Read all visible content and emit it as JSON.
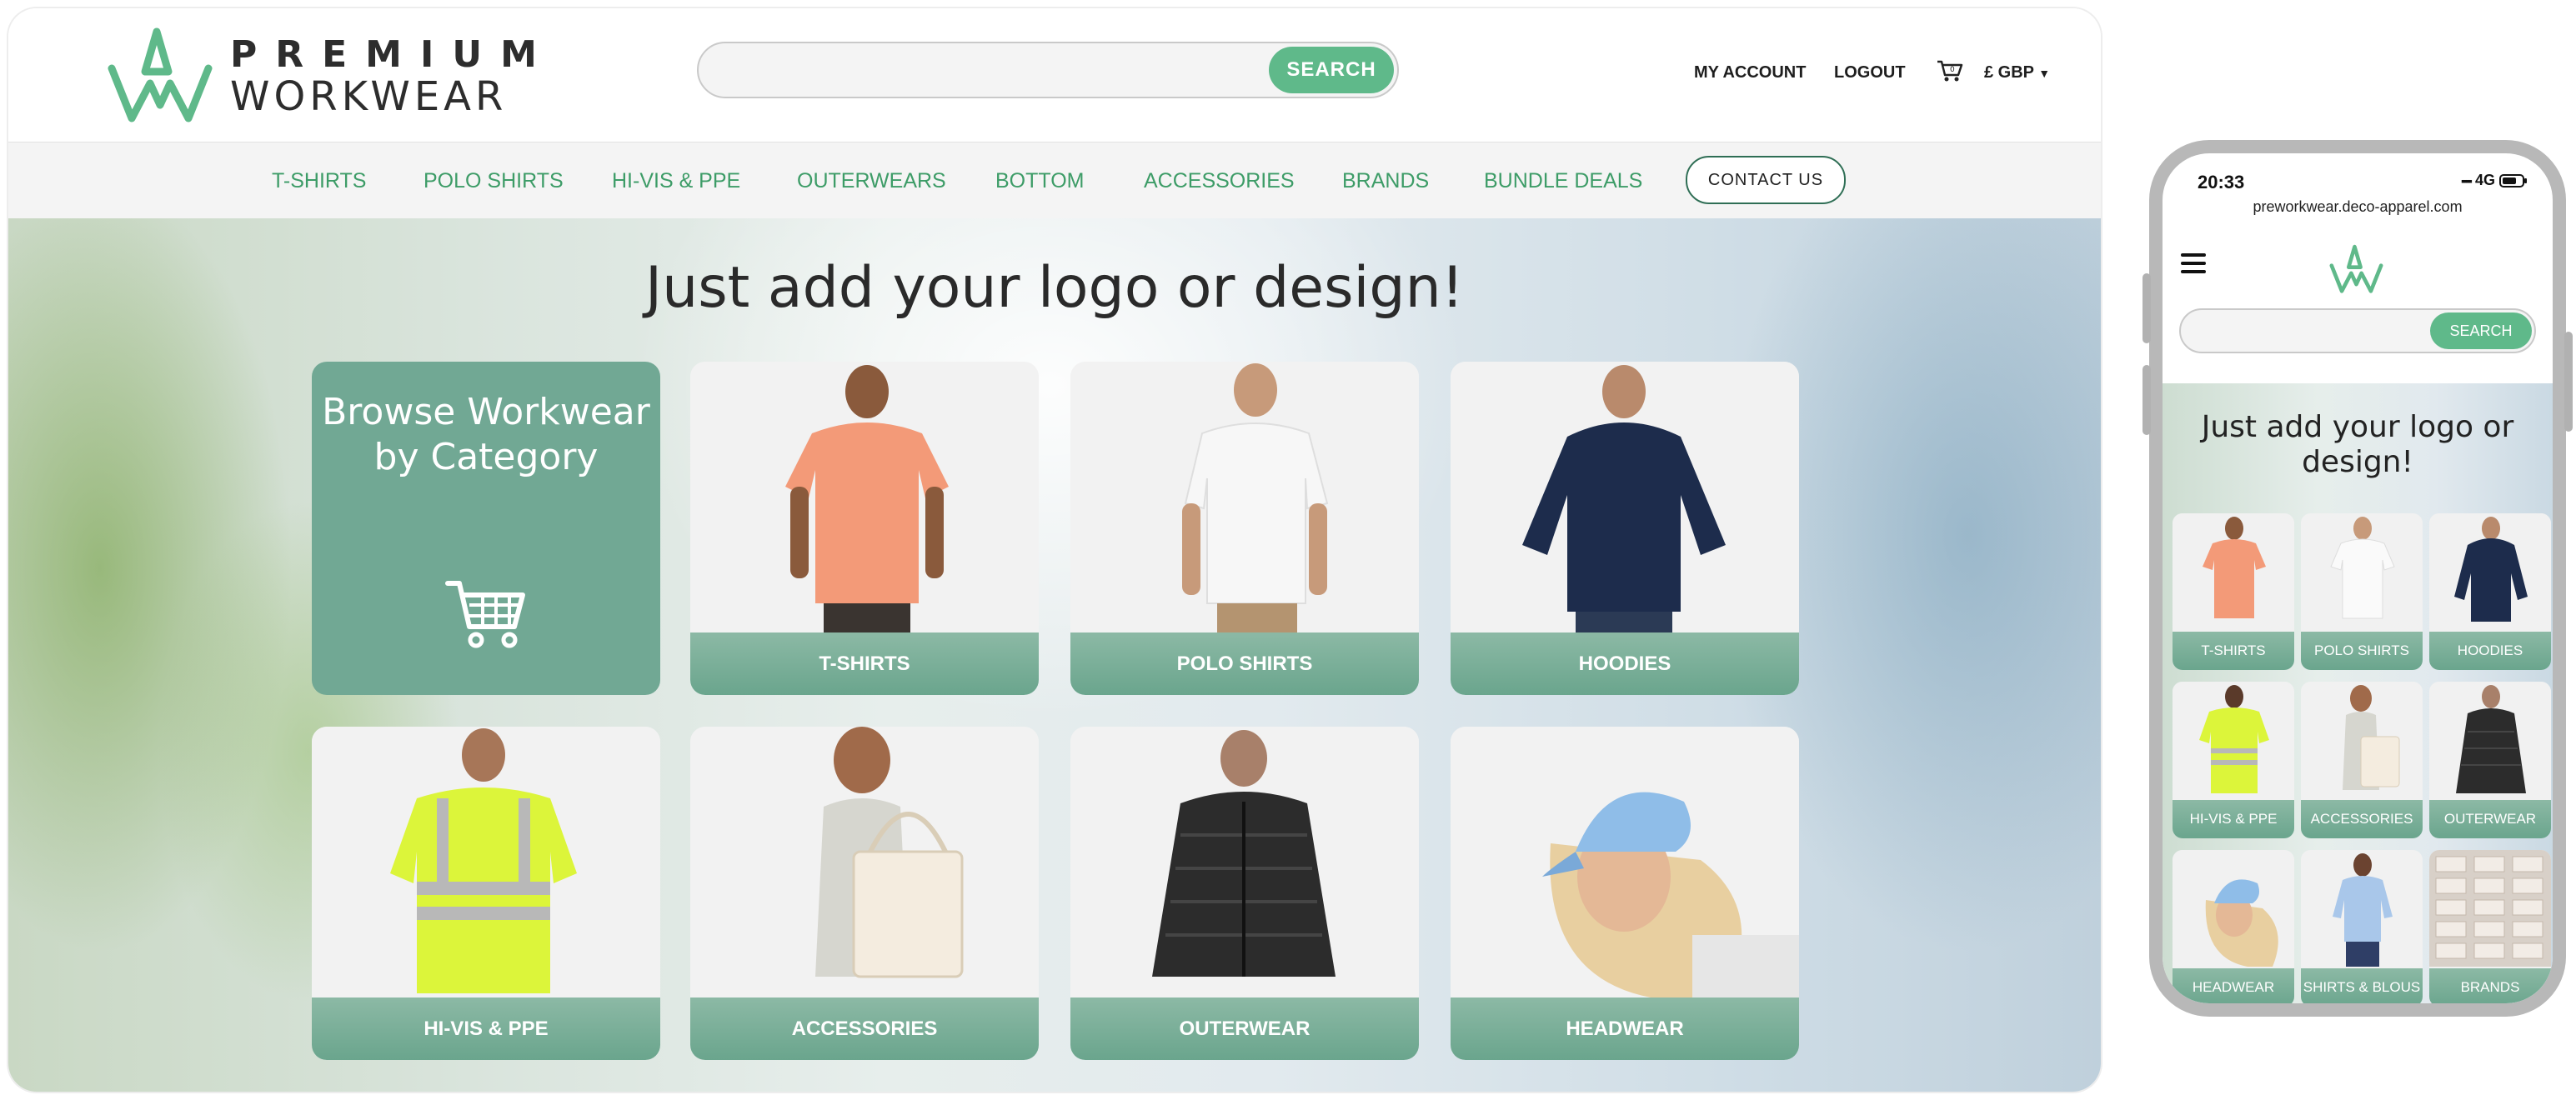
{
  "brand": {
    "line1": "PREMIUM",
    "line2": "WORKWEAR",
    "accent": "#5fb98a"
  },
  "header": {
    "search_placeholder": "",
    "search_button": "SEARCH",
    "my_account": "MY ACCOUNT",
    "logout": "LOGOUT",
    "currency": "£ GBP"
  },
  "nav": {
    "items": [
      "T-SHIRTS",
      "POLO SHIRTS",
      "HI-VIS & PPE",
      "OUTERWEARS",
      "BOTTOM",
      "ACCESSORIES",
      "BRANDS",
      "BUNDLE DEALS"
    ],
    "contact": "CONTACT US"
  },
  "hero": {
    "title": "Just add your logo or design!",
    "browse_text": "Browse Workwear by Category",
    "cards": [
      "T-SHIRTS",
      "POLO SHIRTS",
      "HOODIES",
      "HI-VIS & PPE",
      "ACCESSORIES",
      "OUTERWEAR",
      "HEADWEAR"
    ]
  },
  "mobile": {
    "time": "20:33",
    "network": "4G",
    "url": "preworkwear.deco-apparel.com",
    "search_button": "SEARCH",
    "title": "Just add your logo or design!",
    "cards": [
      "T-SHIRTS",
      "POLO SHIRTS",
      "HOODIES",
      "HI-VIS & PPE",
      "ACCESSORIES",
      "OUTERWEAR",
      "HEADWEAR",
      "SHIRTS & BLOUS",
      "BRANDS"
    ]
  },
  "colors": {
    "brand_green": "#5fb98a",
    "nav_text": "#3d9c67",
    "card_label": "#6aa58d",
    "browse_tile": "#71a894"
  }
}
